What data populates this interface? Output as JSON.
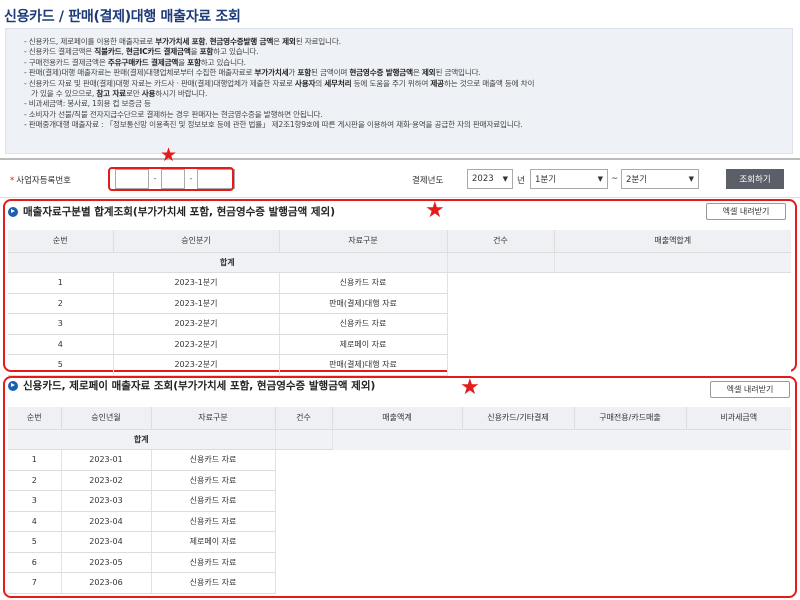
{
  "page_title": "신용카드 / 판매(결제)대행 매출자료 조회",
  "notice": [
    {
      "parts": [
        [
          "n",
          "신용카드, 제로페이를 이용한 매출자료로 "
        ],
        [
          "b",
          "부가가치세 포함"
        ],
        [
          "n",
          ", "
        ],
        [
          "b",
          "현금영수증발행 금액"
        ],
        [
          "n",
          "은 "
        ],
        [
          "b",
          "제외"
        ],
        [
          "n",
          "된 자료입니다."
        ]
      ]
    },
    {
      "parts": [
        [
          "n",
          "신용카드 결제금액은 "
        ],
        [
          "b",
          "직불카드"
        ],
        [
          "n",
          ", "
        ],
        [
          "b",
          "현금IC카드 결제금액"
        ],
        [
          "n",
          "을 "
        ],
        [
          "b",
          "포함"
        ],
        [
          "n",
          "하고 있습니다."
        ]
      ]
    },
    {
      "parts": [
        [
          "n",
          "구매전용카드 결제금액은 "
        ],
        [
          "b",
          "주유구매카드 결제금액"
        ],
        [
          "n",
          "을 "
        ],
        [
          "b",
          "포함"
        ],
        [
          "n",
          "하고 있습니다."
        ]
      ]
    },
    {
      "parts": [
        [
          "n",
          "판매(결제)대행 매출자료는 판매(결제)대행업체로부터 수집한 매출자료로 "
        ],
        [
          "b",
          "부가가치세"
        ],
        [
          "n",
          "가 "
        ],
        [
          "b",
          "포함"
        ],
        [
          "n",
          "된 금액이며 "
        ],
        [
          "b",
          "현금영수증 발행금액"
        ],
        [
          "n",
          "은 "
        ],
        [
          "b",
          "제외"
        ],
        [
          "n",
          "된 금액입니다."
        ]
      ]
    },
    {
      "parts": [
        [
          "n",
          "신용카드 자료 및 판매(결제)대행 자료는 카드사 · 판매(결제)대행업체가 제출한 자료로 "
        ],
        [
          "b",
          "사용자"
        ],
        [
          "n",
          "의 "
        ],
        [
          "b",
          "세무처리"
        ],
        [
          "n",
          " 등에 도움을 주기 위하여 "
        ],
        [
          "b",
          "제공"
        ],
        [
          "n",
          "하는 것으로 매출액 등에 차이"
        ]
      ]
    },
    {
      "cont": true,
      "parts": [
        [
          "n",
          "가 있을 수 있으므로, "
        ],
        [
          "b",
          "참고 자료"
        ],
        [
          "n",
          "로만 "
        ],
        [
          "b",
          "사용"
        ],
        [
          "n",
          "하시기 바랍니다."
        ]
      ]
    },
    {
      "parts": [
        [
          "n",
          "비과세금액: 봉사료, 1회용 컵 보증금 등"
        ]
      ]
    },
    {
      "parts": [
        [
          "n",
          "소비자가 선불/직불 전자지급수단으로 결제하는 경우 판매자는 현금영수증을 발행하면 안됩니다."
        ]
      ]
    },
    {
      "parts": [
        [
          "n",
          "판매중개대행 매출자료 : 「정보통신망 이용촉진 및 정보보호 등에 관한 법률」 제2조1항9호에 따른 게시판을 이용하여 재화·용역을 공급한 자의 판매자료입니다."
        ]
      ]
    }
  ],
  "search": {
    "bizno_label": "사업자등록번호",
    "bizno_required_mark": "*",
    "bizno_part1": "",
    "bizno_part2": "",
    "bizno_part3": "",
    "year_label": "결제년도",
    "year_value": "2023",
    "year_suffix": "년",
    "from_quarter": "1분기",
    "tilde": "~",
    "to_quarter": "2분기",
    "search_button": "조회하기"
  },
  "section1": {
    "title": "매출자료구분별 합계조회(부가가치세 포함, 현금영수증 발행금액 제외)",
    "excel_button": "엑셀 내려받기",
    "headers": [
      "순번",
      "승인분기",
      "자료구분",
      "건수",
      "매출액합계"
    ],
    "sum_label": "합계",
    "rows": [
      [
        "1",
        "2023-1분기",
        "신용카드 자료"
      ],
      [
        "2",
        "2023-1분기",
        "판매(결제)대행 자료"
      ],
      [
        "3",
        "2023-2분기",
        "신용카드 자료"
      ],
      [
        "4",
        "2023-2분기",
        "제로페이 자료"
      ],
      [
        "5",
        "2023-2분기",
        "판매(결제)대행 자료"
      ]
    ]
  },
  "section2": {
    "title": "신용카드, 제로페이 매출자료 조회(부가가치세 포함, 현금영수증 발행금액 제외)",
    "excel_button": "엑셀 내려받기",
    "headers": [
      "순번",
      "승인년월",
      "자료구분",
      "건수",
      "매출액계",
      "신용카드/기타결제",
      "구매전용/카드매출",
      "비과세금액"
    ],
    "sum_label": "합계",
    "rows": [
      [
        "1",
        "2023-01",
        "신용카드 자료"
      ],
      [
        "2",
        "2023-02",
        "신용카드 자료"
      ],
      [
        "3",
        "2023-03",
        "신용카드 자료"
      ],
      [
        "4",
        "2023-04",
        "신용카드 자료"
      ],
      [
        "5",
        "2023-04",
        "제로페이 자료"
      ],
      [
        "6",
        "2023-05",
        "신용카드 자료"
      ],
      [
        "7",
        "2023-06",
        "신용카드 자료"
      ]
    ]
  },
  "colors": {
    "title": "#1d3b78",
    "highlight": "#e51a1a",
    "bullet": "#1a5fb4",
    "notice_bg": "#eef1f6"
  }
}
